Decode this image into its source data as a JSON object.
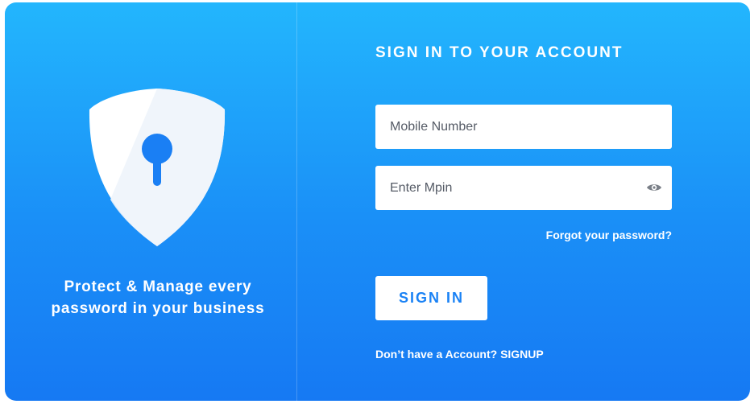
{
  "brand": {
    "tagline_line1": "Protect & Manage every",
    "tagline_line2": "password in your business",
    "icon": "shield-keyhole-icon"
  },
  "login": {
    "title": "SIGN IN TO YOUR ACCOUNT",
    "mobile_placeholder": "Mobile Number",
    "mpin_placeholder": "Enter Mpin",
    "mpin_toggle_icon": "eye-icon",
    "forgot_label": "Forgot your password?",
    "signin_label": "SIGN IN",
    "signup_prompt": "Don’t have a Account?",
    "signup_label": "SIGNUP"
  },
  "colors": {
    "gradient_top": "#23b6fd",
    "gradient_bottom": "#1679f3",
    "button_text": "#1a82f5",
    "keyhole": "#1a7ff4"
  }
}
